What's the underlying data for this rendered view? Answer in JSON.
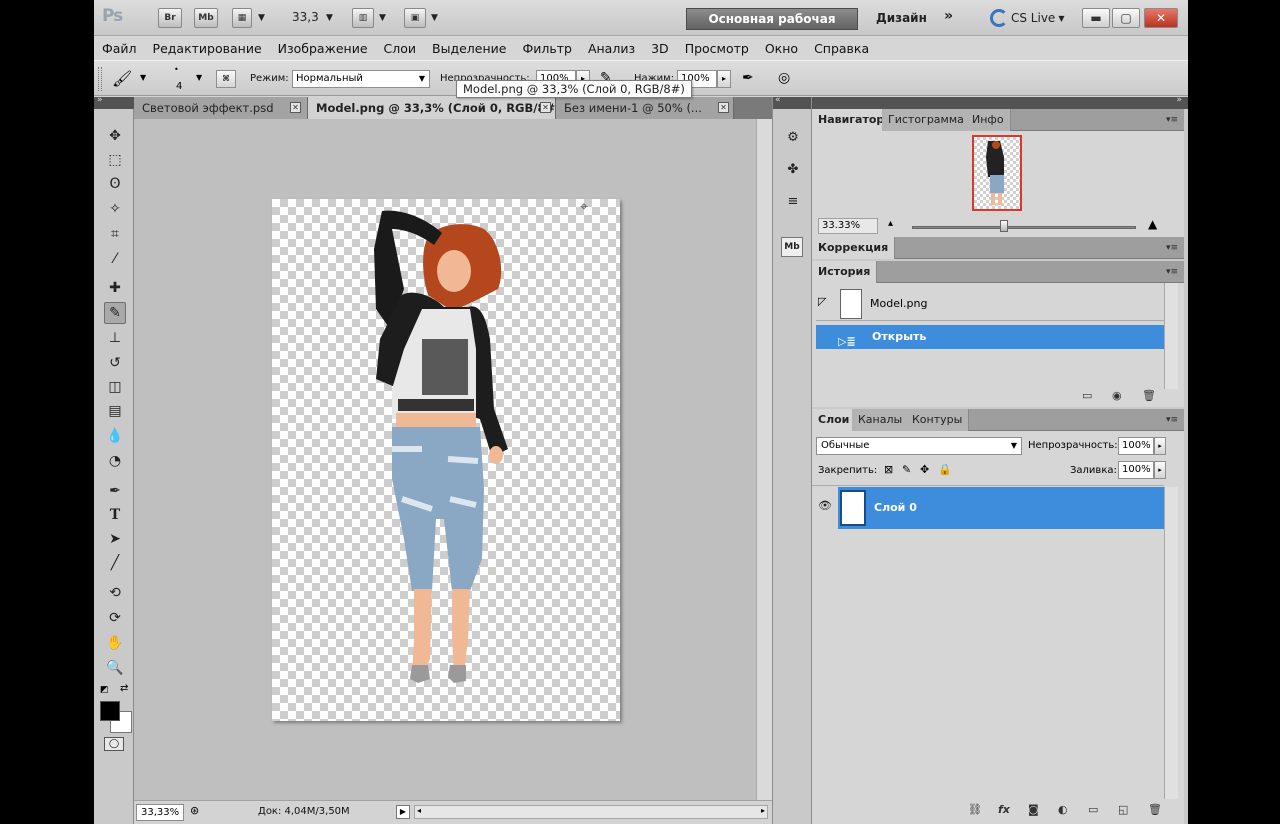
{
  "app": {
    "logo": "Ps"
  },
  "titlebar": {
    "bridge": "Br",
    "minibridge": "Mb",
    "zoom": "33,3",
    "workspace": "Основная рабочая среда",
    "design": "Дизайн",
    "more": "»",
    "cslive": "CS Live"
  },
  "menu": [
    "Файл",
    "Редактирование",
    "Изображение",
    "Слои",
    "Выделение",
    "Фильтр",
    "Анализ",
    "3D",
    "Просмотр",
    "Окно",
    "Справка"
  ],
  "options": {
    "brush_size": "4",
    "mode_label": "Режим:",
    "mode_value": "Нормальный",
    "opacity_label": "Непрозрачность:",
    "opacity_value": "100%",
    "pressure_label": "Нажим:",
    "pressure_value": "100%"
  },
  "tooltip": "Model.png @ 33,3% (Слой 0, RGB/8#)",
  "doc_tabs": [
    {
      "label": "Световой эффект.psd",
      "active": false
    },
    {
      "label": "Model.png @ 33,3% (Слой 0, RGB/8#)",
      "active": true
    },
    {
      "label": "Без имени-1 @ 50% (...",
      "active": false
    }
  ],
  "status": {
    "zoom": "33,33%",
    "doc": "Док: 4,04M/3,50M"
  },
  "navigator": {
    "tabs": [
      "Навигатор",
      "Гистограмма",
      "Инфо"
    ],
    "zoom": "33.33%"
  },
  "correction": {
    "title": "Коррекция"
  },
  "history": {
    "title": "История",
    "snapshot": "Model.png",
    "items": [
      "Открыть"
    ]
  },
  "layers": {
    "tabs": [
      "Слои",
      "Каналы",
      "Контуры"
    ],
    "blend": "Обычные",
    "opacity_label": "Непрозрачность:",
    "opacity_value": "100%",
    "lock_label": "Закрепить:",
    "fill_label": "Заливка:",
    "fill_value": "100%",
    "items": [
      {
        "name": "Слой 0",
        "selected": true
      }
    ]
  },
  "colors": {
    "selection": "#3e8ddd",
    "foreground": "#000000",
    "background": "#ffffff"
  }
}
